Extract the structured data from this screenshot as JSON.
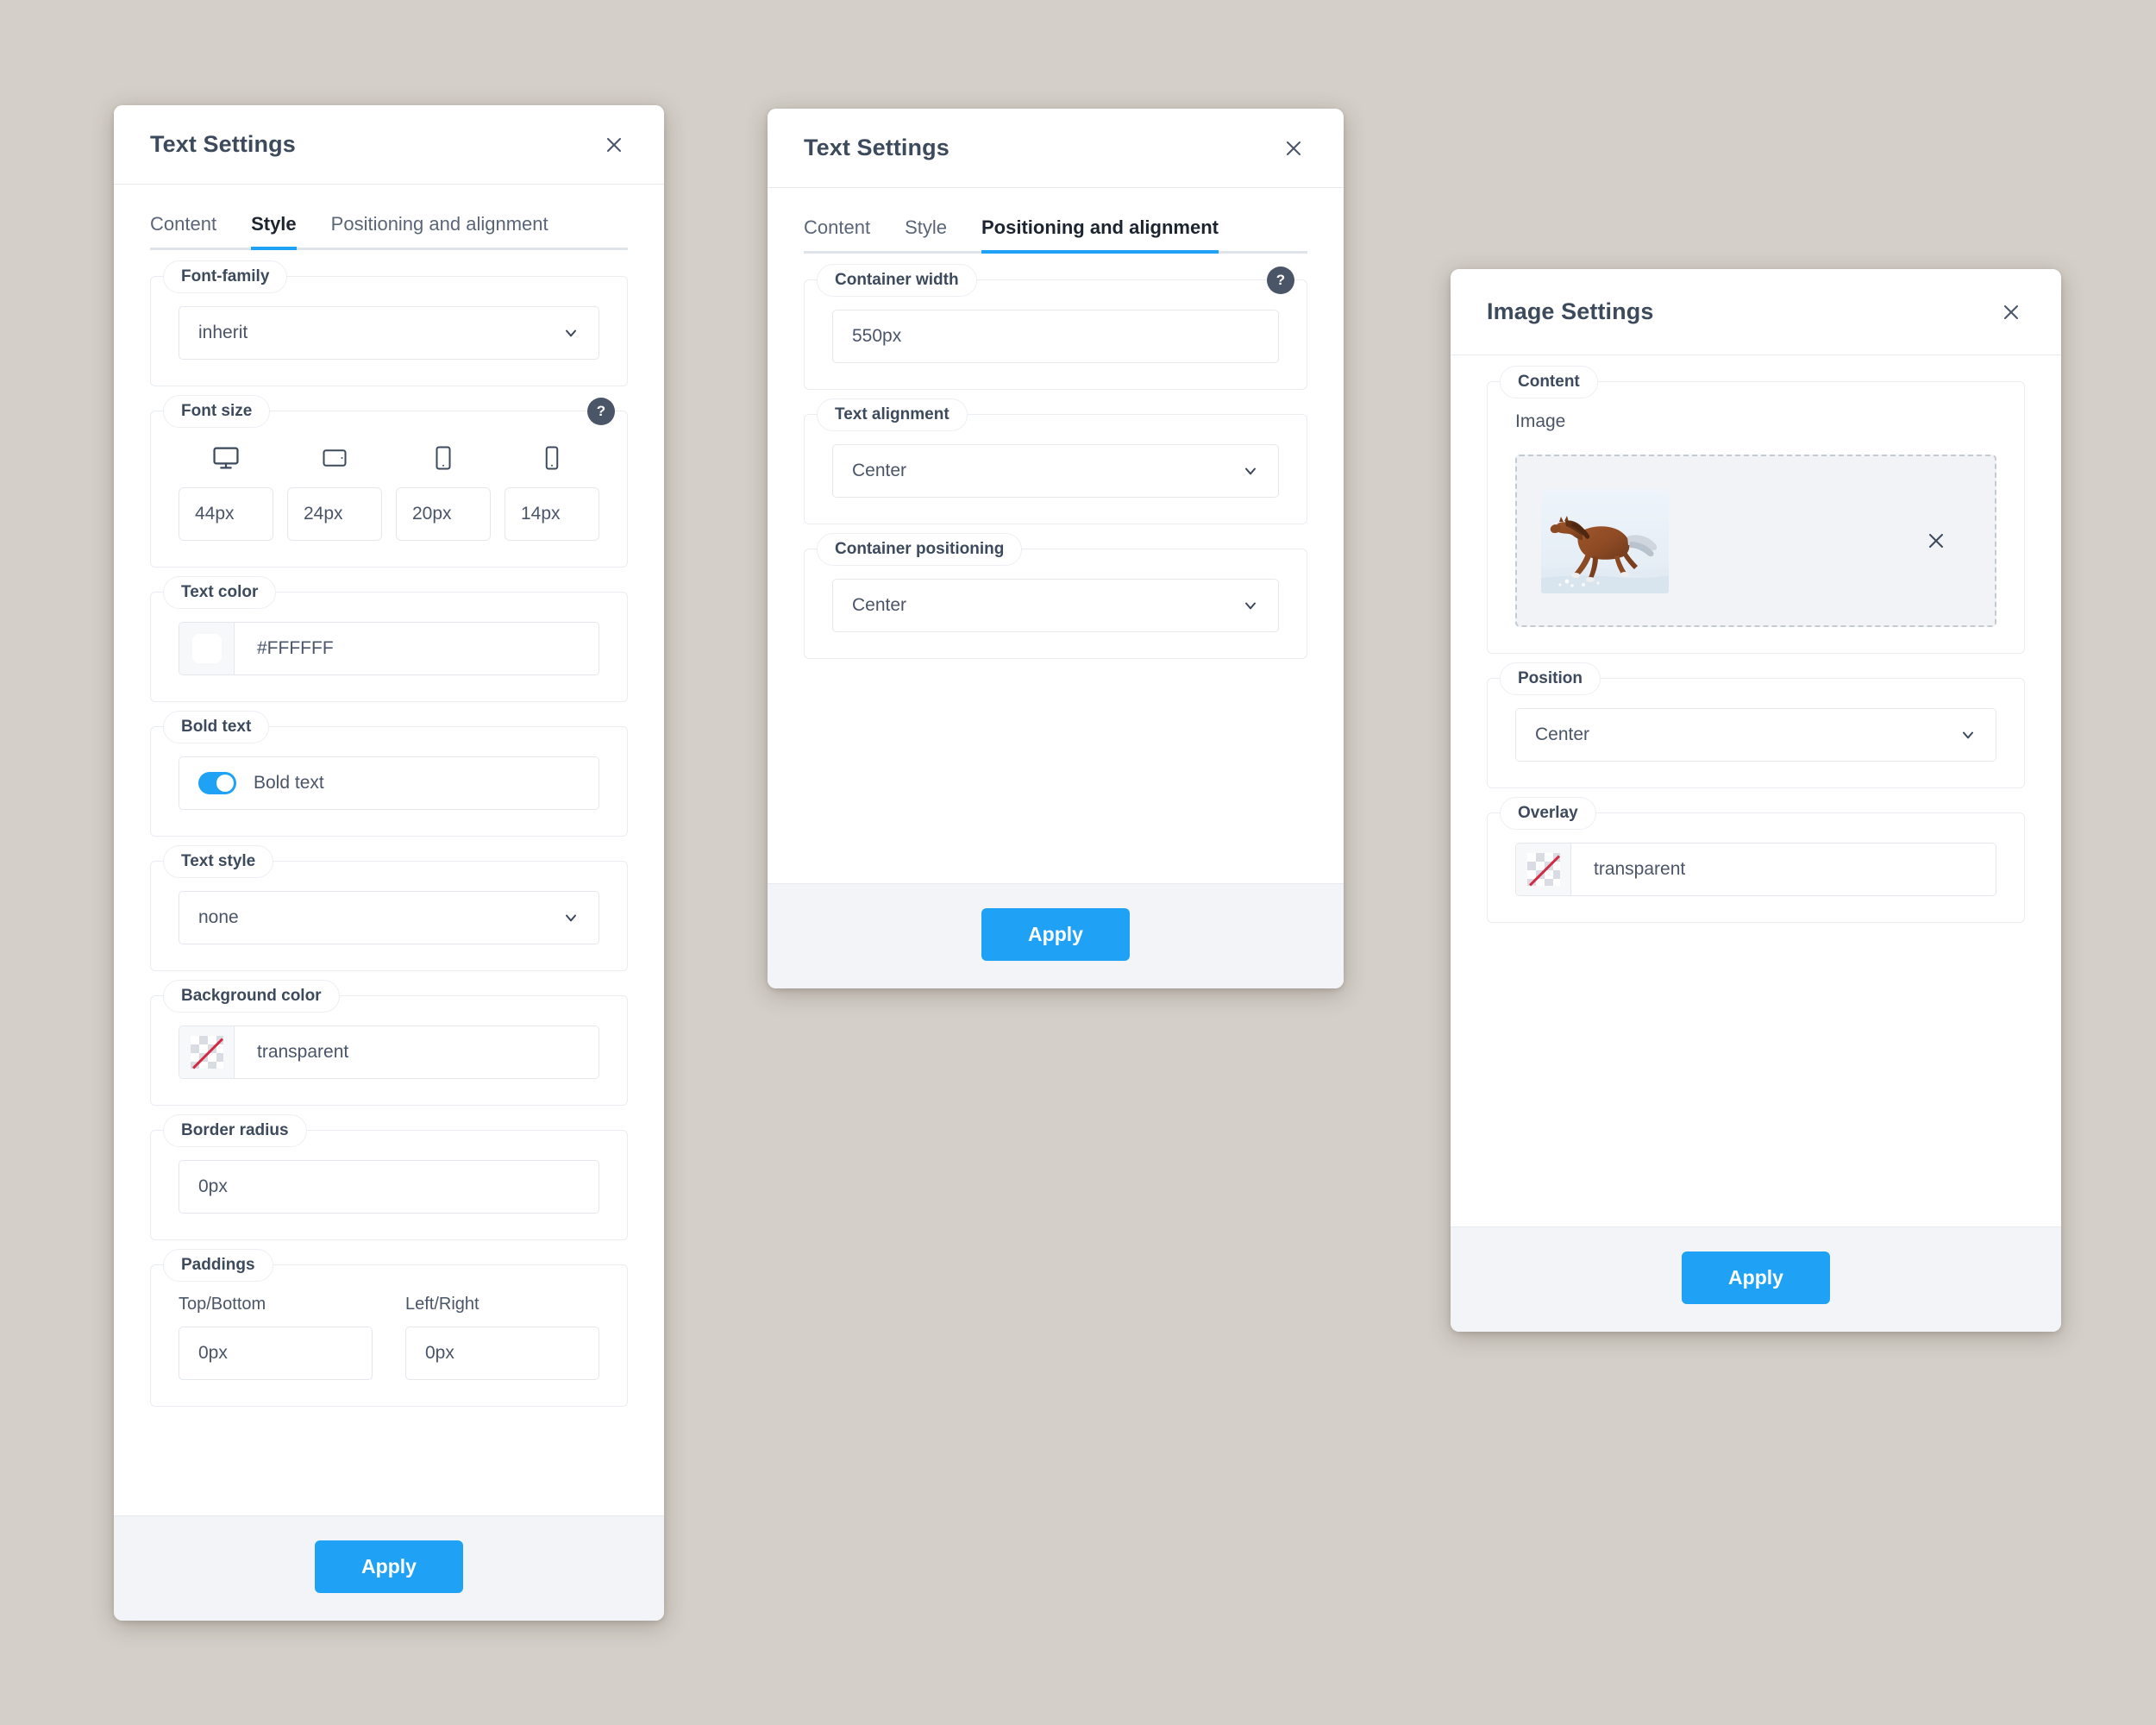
{
  "panels": {
    "text_style": {
      "title": "Text Settings",
      "close_icon": "close-icon",
      "tabs": [
        {
          "label": "Content",
          "active": false
        },
        {
          "label": "Style",
          "active": true
        },
        {
          "label": "Positioning and alignment",
          "active": false
        }
      ],
      "groups": {
        "font_family": {
          "legend": "Font-family",
          "value": "inherit"
        },
        "font_size": {
          "legend": "Font size",
          "help": "?",
          "devices": [
            {
              "icon": "desktop-icon",
              "value": "44px"
            },
            {
              "icon": "tablet-landscape-icon",
              "value": "24px"
            },
            {
              "icon": "tablet-portrait-icon",
              "value": "20px"
            },
            {
              "icon": "mobile-icon",
              "value": "14px"
            }
          ]
        },
        "text_color": {
          "legend": "Text color",
          "value": "#FFFFFF",
          "swatch": "#FFFFFF"
        },
        "bold_text": {
          "legend": "Bold text",
          "toggle_label": "Bold text",
          "enabled": true,
          "accent": "#1FA2F5"
        },
        "text_style": {
          "legend": "Text style",
          "value": "none"
        },
        "background_color": {
          "legend": "Background color",
          "value": "transparent",
          "swatch": "transparent"
        },
        "border_radius": {
          "legend": "Border radius",
          "value": "0px"
        },
        "paddings": {
          "legend": "Paddings",
          "top_bottom_label": "Top/Bottom",
          "top_bottom_value": "0px",
          "left_right_label": "Left/Right",
          "left_right_value": "0px"
        }
      },
      "apply_label": "Apply"
    },
    "text_positioning": {
      "title": "Text Settings",
      "close_icon": "close-icon",
      "tabs": [
        {
          "label": "Content",
          "active": false
        },
        {
          "label": "Style",
          "active": false
        },
        {
          "label": "Positioning and alignment",
          "active": true
        }
      ],
      "groups": {
        "container_width": {
          "legend": "Container width",
          "help": "?",
          "value": "550px"
        },
        "text_alignment": {
          "legend": "Text alignment",
          "value": "Center"
        },
        "container_positioning": {
          "legend": "Container positioning",
          "value": "Center"
        }
      },
      "apply_label": "Apply"
    },
    "image": {
      "title": "Image Settings",
      "close_icon": "close-icon",
      "groups": {
        "content": {
          "legend": "Content",
          "image_label": "Image",
          "thumbnail_alt": "brown horse galloping in snow",
          "remove_icon": "close-icon"
        },
        "position": {
          "legend": "Position",
          "value": "Center"
        },
        "overlay": {
          "legend": "Overlay",
          "value": "transparent",
          "swatch": "transparent"
        }
      },
      "apply_label": "Apply"
    }
  },
  "theme": {
    "accent": "#1FA2F5",
    "text_dark": "#3D4A5C",
    "text_muted": "#4A5568",
    "page_bg": "#D4CFC8",
    "footer_bg": "#F2F4F7",
    "border": "#E4E8ED"
  }
}
